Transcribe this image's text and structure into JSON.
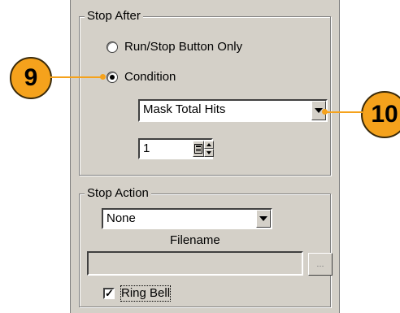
{
  "stop_after": {
    "title": "Stop After",
    "options": [
      {
        "label": "Run/Stop Button Only",
        "selected": false
      },
      {
        "label": "Condition",
        "selected": true
      }
    ],
    "condition_select": "Mask Total Hits",
    "count_value": "1"
  },
  "stop_action": {
    "title": "Stop Action",
    "action_select": "None",
    "filename_label": "Filename",
    "filename_value": "",
    "browse_label": "...",
    "ring_bell_label": "Ring Bell",
    "ring_bell_checked": true
  },
  "callouts": {
    "left": "9",
    "right": "10"
  },
  "colors": {
    "callout": "#f5a21c",
    "panel": "#d4d0c8"
  }
}
